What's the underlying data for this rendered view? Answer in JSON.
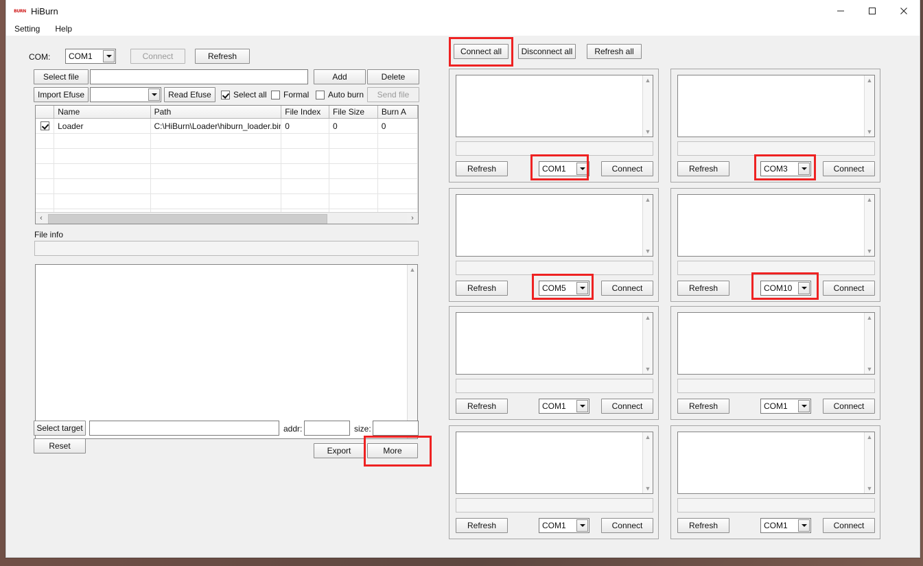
{
  "window": {
    "title": "HiBurn",
    "icon": "burn-logo-icon",
    "minimize": "—",
    "maximize": "□",
    "close": "×"
  },
  "menubar": {
    "items": [
      "Setting",
      "Help"
    ]
  },
  "left_panel": {
    "com_label": "COM:",
    "com_value": "COM1",
    "connect_button": "Connect",
    "refresh_button": "Refresh",
    "select_file_button": "Select file",
    "file_path_value": "",
    "add_button": "Add",
    "delete_button": "Delete",
    "import_efuse_button": "Import Efuse",
    "efuse_combo_value": "",
    "read_efuse_button": "Read Efuse",
    "select_all_label": "Select all",
    "select_all_checked": true,
    "formal_label": "Formal",
    "formal_checked": false,
    "auto_burn_label": "Auto burn",
    "auto_burn_checked": false,
    "send_file_button": "Send file",
    "send_file_disabled": true,
    "table": {
      "columns": [
        "",
        "Name",
        "Path",
        "File Index",
        "File Size",
        "Burn A"
      ],
      "rows": [
        {
          "checked": true,
          "name": "Loader",
          "path": "C:\\HiBurn\\Loader\\hiburn_loader.bin",
          "file_index": "0",
          "file_size": "0",
          "burn_addr": "0"
        }
      ],
      "empty_rows": 6
    },
    "file_info_label": "File info",
    "file_info_value": "",
    "log_value": "",
    "select_target_button": "Select target",
    "target_value": "",
    "addr_label": "addr:",
    "addr_value": "",
    "size_label": "size:",
    "size_value": "",
    "reset_button": "Reset",
    "export_button": "Export",
    "more_button": "More"
  },
  "right_panel": {
    "connect_all_button": "Connect all",
    "disconnect_all_button": "Disconnect all",
    "refresh_all_button": "Refresh all",
    "device_refresh_label": "Refresh",
    "device_connect_label": "Connect",
    "devices": [
      {
        "id": 1,
        "com": "COM1",
        "log": "",
        "status": "",
        "highlighted": true
      },
      {
        "id": 2,
        "com": "COM3",
        "log": "",
        "status": "",
        "highlighted": true
      },
      {
        "id": 3,
        "com": "COM5",
        "log": "",
        "status": "",
        "highlighted": true
      },
      {
        "id": 4,
        "com": "COM10",
        "log": "",
        "status": "",
        "highlighted": true
      },
      {
        "id": 5,
        "com": "COM1",
        "log": "",
        "status": "",
        "highlighted": false
      },
      {
        "id": 6,
        "com": "COM1",
        "log": "",
        "status": "",
        "highlighted": false
      },
      {
        "id": 7,
        "com": "COM1",
        "log": "",
        "status": "",
        "highlighted": false
      },
      {
        "id": 8,
        "com": "COM1",
        "log": "",
        "status": "",
        "highlighted": false
      }
    ]
  },
  "annotations": {
    "color": "#ee2222",
    "targets": [
      "Connect all",
      "COM1",
      "COM3",
      "COM5",
      "COM10",
      "More"
    ]
  }
}
